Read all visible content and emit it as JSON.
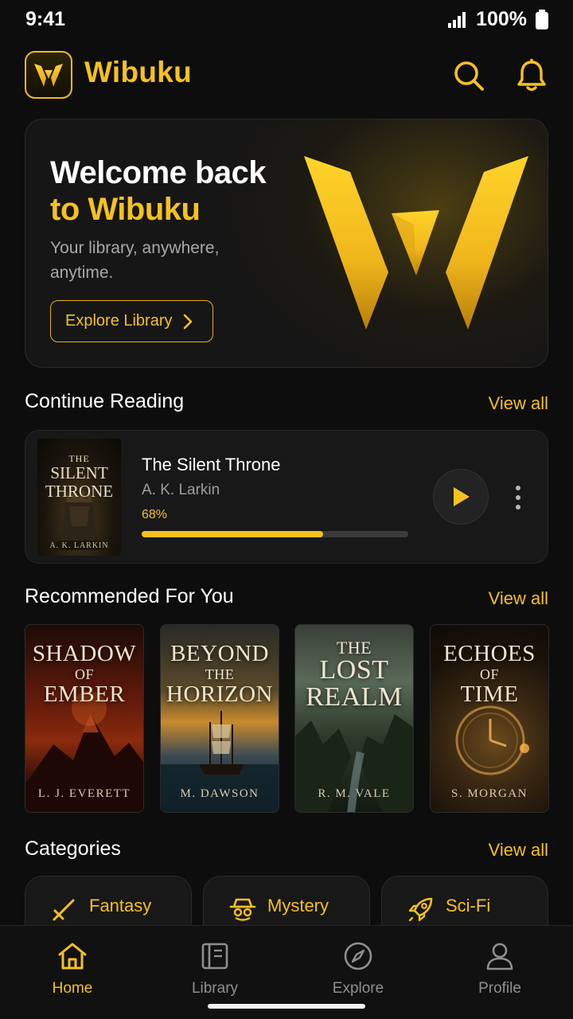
{
  "status_bar": {
    "time": "9:41",
    "battery": "100%"
  },
  "header": {
    "brand": "Wibuku",
    "icons": [
      "search-icon",
      "bell-icon"
    ]
  },
  "hero": {
    "title_line1": "Welcome back",
    "title_line2": "to Wibuku",
    "subtitle": "Your library, anywhere, anytime.",
    "button": "Explore Library"
  },
  "continue_reading": {
    "title": "Continue Reading",
    "view_all": "View all",
    "book": {
      "cover_small": "THE",
      "cover_title": "SILENT THRONE",
      "cover_author": "A. K. LARKIN",
      "title": "The Silent Throne",
      "author": "A. K. Larkin",
      "progress_text": "68%",
      "progress": 0.68
    }
  },
  "recommended": {
    "title": "Recommended For You",
    "view_all": "View all",
    "books": [
      {
        "top": "SHADOW",
        "mid": "OF",
        "bottom": "EMBER",
        "author": "L. J. EVERETT"
      },
      {
        "top": "BEYOND",
        "mid": "THE",
        "bottom": "HORIZON",
        "author": "M. DAWSON"
      },
      {
        "top": "THE",
        "mid": "LOST",
        "bottom": "REALM",
        "author": "R. M. VALE"
      },
      {
        "top": "ECHOES",
        "mid": "OF",
        "bottom": "TIME",
        "author": "S. MORGAN"
      }
    ]
  },
  "categories": {
    "title": "Categories",
    "view_all": "View all",
    "items": [
      {
        "label": "Fantasy",
        "icon": "sword-icon"
      },
      {
        "label": "Mystery",
        "icon": "detective-icon"
      },
      {
        "label": "Sci-Fi",
        "icon": "rocket-icon"
      }
    ]
  },
  "nav": {
    "items": [
      {
        "label": "Home",
        "icon": "home-icon",
        "active": true
      },
      {
        "label": "Library",
        "icon": "library-icon",
        "active": false
      },
      {
        "label": "Explore",
        "icon": "compass-icon",
        "active": false
      },
      {
        "label": "Profile",
        "icon": "profile-icon",
        "active": false
      }
    ]
  },
  "colors": {
    "accent": "#f6c11f",
    "background": "#0d0d0d",
    "card": "#181818"
  }
}
